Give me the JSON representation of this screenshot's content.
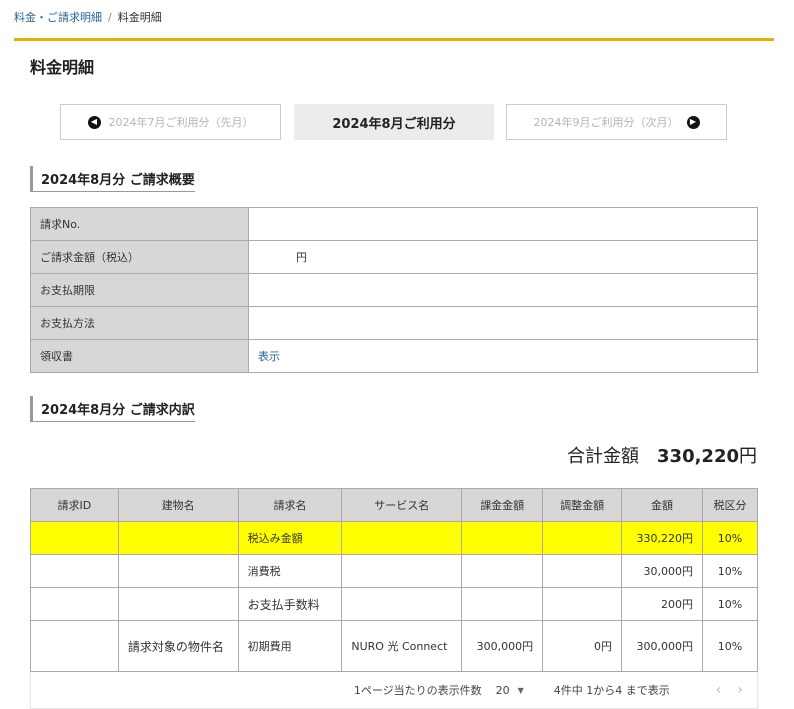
{
  "breadcrumb": {
    "parent": "料金・ご請求明細",
    "separator": "/",
    "current": "料金明細"
  },
  "page_title": "料金明細",
  "month_nav": {
    "prev_label": "2024年7月ご利用分（先月）",
    "current_label": "2024年8月ご利用分",
    "next_label": "2024年9月ご利用分（次月）"
  },
  "summary": {
    "heading": "2024年8月分 ご請求概要",
    "rows": {
      "invoice_no": {
        "label": "請求No.",
        "value": ""
      },
      "amount": {
        "label": "ご請求金額（税込）",
        "value": "円"
      },
      "due_date": {
        "label": "お支払期限",
        "value": ""
      },
      "method": {
        "label": "お支払方法",
        "value": ""
      },
      "receipt": {
        "label": "領収書",
        "value": "表示"
      }
    }
  },
  "breakdown": {
    "heading": "2024年8月分 ご請求内訳",
    "total_label": "合計金額",
    "total_amount": "330,220",
    "total_unit": "円",
    "columns": [
      "請求ID",
      "建物名",
      "請求名",
      "サービス名",
      "課金金額",
      "調整金額",
      "金額",
      "税区分"
    ],
    "rows": [
      [
        "",
        "",
        "税込み金額",
        "",
        "",
        "",
        "330,220円",
        "10%"
      ],
      [
        "",
        "",
        "消費税",
        "",
        "",
        "",
        "30,000円",
        "10%"
      ],
      [
        "",
        "",
        "お支払手数料",
        "",
        "",
        "",
        "200円",
        "10%"
      ],
      [
        "",
        "請求対象の物件名",
        "初期費用",
        "NURO 光 Connect",
        "300,000円",
        "0円",
        "300,000円",
        "10%"
      ]
    ]
  },
  "pagination": {
    "per_page_label": "1ページ当たりの表示件数",
    "per_page_value": "20",
    "range_text": "4件中 1から4 まで表示"
  },
  "colors": {
    "accent": "#e5b000",
    "link": "#2a6496",
    "highlight": "#ffff00",
    "header_bg": "#d9d6d6"
  }
}
